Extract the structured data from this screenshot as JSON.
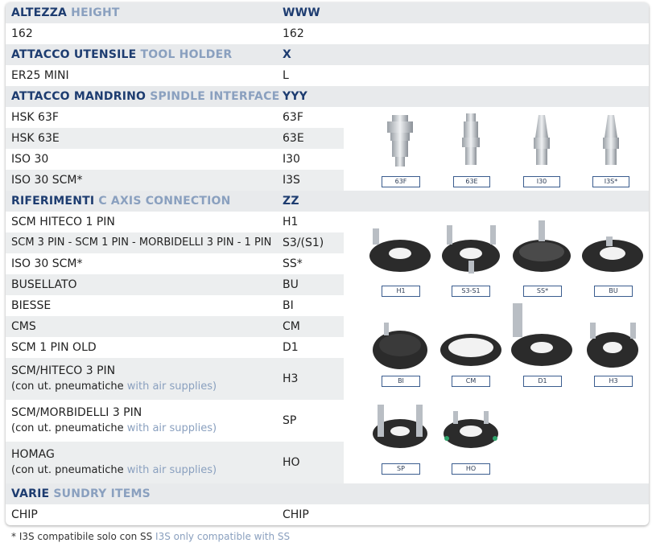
{
  "sections": {
    "height": {
      "it": "ALTEZZA",
      "en": "HEIGHT",
      "code": "WWW"
    },
    "tool_holder": {
      "it": "ATTACCO UTENSILE",
      "en": "TOOL HOLDER",
      "code": "X"
    },
    "spindle": {
      "it": "ATTACCO MANDRINO",
      "en": "SPINDLE INTERFACE",
      "code": "YYY"
    },
    "caxis": {
      "it": "RIFERIMENTI",
      "en": "C AXIS CONNECTION",
      "code": "ZZ"
    },
    "sundry": {
      "it": "VARIE",
      "en": "SUNDRY ITEMS",
      "code": ""
    }
  },
  "height_rows": [
    {
      "label": "162",
      "code": "162"
    }
  ],
  "tool_rows": [
    {
      "label": "ER25 MINI",
      "code": "L"
    }
  ],
  "spindle_rows": [
    {
      "label": "HSK 63F",
      "code": "63F"
    },
    {
      "label": "HSK 63E",
      "code": "63E"
    },
    {
      "label": "ISO 30",
      "code": "I30"
    },
    {
      "label": "ISO 30 SCM*",
      "code": "I3S"
    }
  ],
  "caxis_rows": [
    {
      "label": "SCM HITECO 1 PIN",
      "code": "H1"
    },
    {
      "label": "SCM 3 PIN - SCM 1 PIN - MORBIDELLI 3 PIN - 1 PIN",
      "code": "S3/(S1)"
    },
    {
      "label": "ISO 30 SCM*",
      "code": "SS*"
    },
    {
      "label": "BUSELLATO",
      "code": "BU"
    },
    {
      "label": "BIESSE",
      "code": "BI"
    },
    {
      "label": "CMS",
      "code": "CM"
    },
    {
      "label": "SCM 1 PIN OLD",
      "code": "D1"
    }
  ],
  "caxis_double": [
    {
      "label": "SCM/HITECO 3 PIN",
      "sub_it": "(con ut. pneumatiche",
      "sub_en": "with air supplies)",
      "code": "H3"
    },
    {
      "label": "SCM/MORBIDELLI 3 PIN",
      "sub_it": "(con ut. pneumatiche",
      "sub_en": "with air supplies)",
      "code": "SP"
    },
    {
      "label": "HOMAG",
      "sub_it": "(con ut. pneumatiche",
      "sub_en": "with air supplies)",
      "code": "HO"
    }
  ],
  "sundry_rows": [
    {
      "label": "CHIP",
      "code": "CHIP"
    }
  ],
  "spindle_tags": [
    "63F",
    "63E",
    "I30",
    "I3S*"
  ],
  "caxis_tags_row1": [
    "H1",
    "S3-S1",
    "SS*",
    "BU"
  ],
  "caxis_tags_row2": [
    "BI",
    "CM",
    "D1",
    "H3"
  ],
  "caxis_tags_row3": [
    "SP",
    "HO"
  ],
  "footnote": {
    "it": "* I3S compatibile solo con SS",
    "en": "I3S only compatible with SS"
  }
}
